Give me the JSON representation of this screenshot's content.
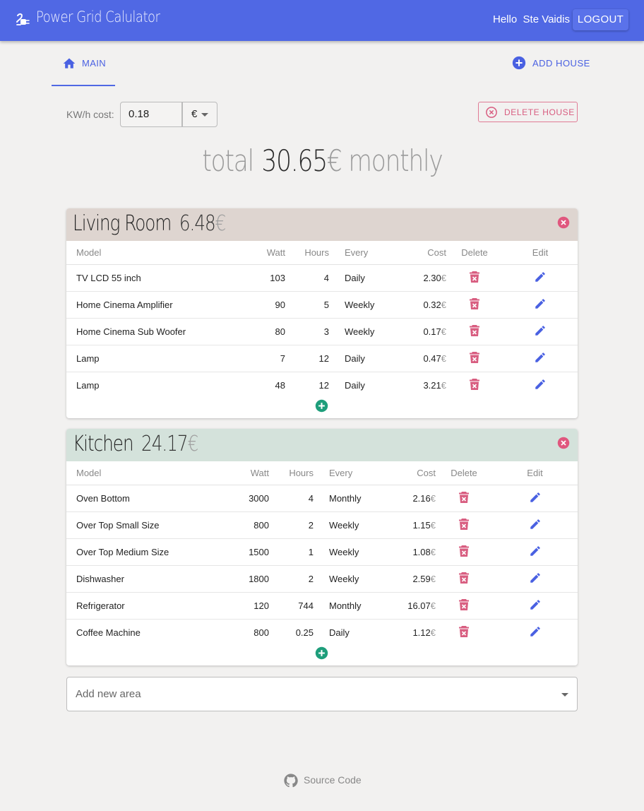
{
  "app": {
    "title": "Power Grid Calulator"
  },
  "header": {
    "greeting": "Hello  Ste Vaidis",
    "logout_label": "LOGOUT"
  },
  "tabs": [
    {
      "label": "MAIN",
      "icon": "home-icon",
      "active": true
    }
  ],
  "add_house_label": "ADD HOUSE",
  "settings": {
    "kwh_label": "KW/h cost:",
    "kwh_value": "0.18",
    "currency": "€"
  },
  "delete_house_label": "DELETE HOUSE",
  "total": {
    "prefix": "total",
    "value": "30.65",
    "currency": "€",
    "suffix": "monthly"
  },
  "columns": {
    "model": "Model",
    "watt": "Watt",
    "hours": "Hours",
    "every": "Every",
    "cost": "Cost",
    "delete": "Delete",
    "edit": "Edit"
  },
  "areas": [
    {
      "name": "Living Room",
      "total": "6.48",
      "currency": "€",
      "color": "#ded5d0",
      "rows": [
        {
          "model": "TV LCD 55 inch",
          "watt": "103",
          "hours": "4",
          "every": "Daily",
          "cost": "2.30"
        },
        {
          "model": "Home Cinema Amplifier",
          "watt": "90",
          "hours": "5",
          "every": "Weekly",
          "cost": "0.32"
        },
        {
          "model": "Home Cinema Sub Woofer",
          "watt": "80",
          "hours": "3",
          "every": "Weekly",
          "cost": "0.17"
        },
        {
          "model": "Lamp",
          "watt": "7",
          "hours": "12",
          "every": "Daily",
          "cost": "0.47"
        },
        {
          "model": "Lamp",
          "watt": "48",
          "hours": "12",
          "every": "Daily",
          "cost": "3.21"
        }
      ]
    },
    {
      "name": "Kitchen",
      "total": "24.17",
      "currency": "€",
      "color": "#d4e2db",
      "rows": [
        {
          "model": "Oven Bottom",
          "watt": "3000",
          "hours": "4",
          "every": "Monthly",
          "cost": "2.16"
        },
        {
          "model": "Over Top Small Size",
          "watt": "800",
          "hours": "2",
          "every": "Weekly",
          "cost": "1.15"
        },
        {
          "model": "Over Top Medium Size",
          "watt": "1500",
          "hours": "1",
          "every": "Weekly",
          "cost": "1.08"
        },
        {
          "model": "Dishwasher",
          "watt": "1800",
          "hours": "2",
          "every": "Weekly",
          "cost": "2.59"
        },
        {
          "model": "Refrigerator",
          "watt": "120",
          "hours": "744",
          "every": "Monthly",
          "cost": "16.07"
        },
        {
          "model": "Coffee Machine",
          "watt": "800",
          "hours": "0.25",
          "every": "Daily",
          "cost": "1.12"
        }
      ]
    }
  ],
  "add_area_placeholder": "Add new area",
  "footer": {
    "source_label": "Source Code"
  },
  "colors": {
    "primary": "#5068e4",
    "danger": "#d85d80",
    "success": "#1e9e7b"
  }
}
